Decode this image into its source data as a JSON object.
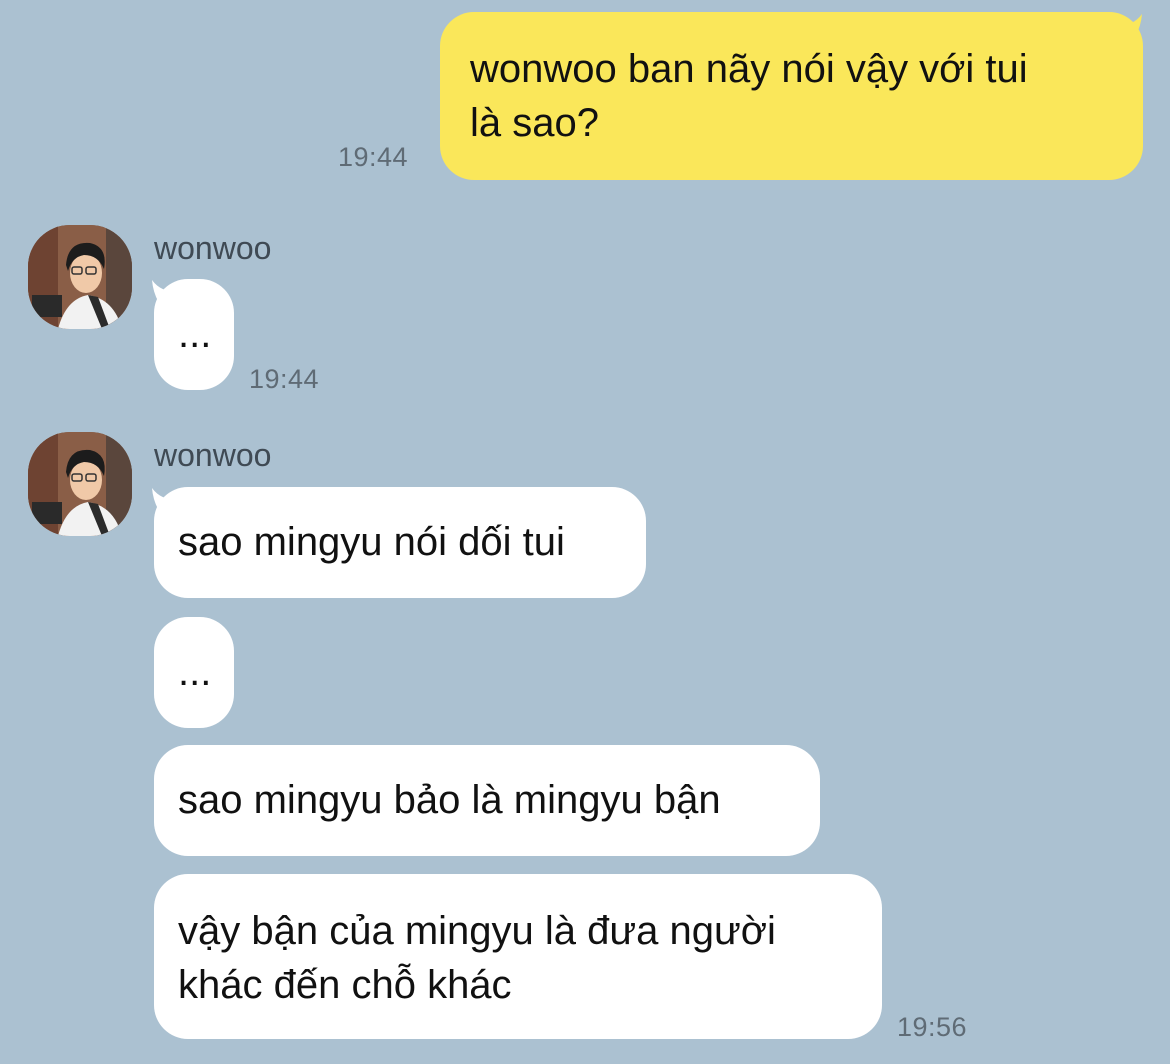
{
  "chat": {
    "outgoing": [
      {
        "text": "wonwoo ban nãy nói vậy với tui\nlà sao?",
        "time": "19:44"
      }
    ],
    "groups": [
      {
        "sender": "wonwoo",
        "avatar_icon": "profile-photo-avatar",
        "messages": [
          {
            "text": "..."
          }
        ],
        "time": "19:44"
      },
      {
        "sender": "wonwoo",
        "avatar_icon": "profile-photo-avatar",
        "messages": [
          {
            "text": "sao mingyu nói dối tui"
          },
          {
            "text": "..."
          },
          {
            "text": "sao mingyu bảo là mingyu bận"
          },
          {
            "text": "vậy bận của mingyu là đưa người\nkhác đến chỗ khác"
          }
        ],
        "time": "19:56"
      }
    ]
  },
  "colors": {
    "background": "#abc1d1",
    "outgoing_bubble": "#fae75a",
    "incoming_bubble": "#ffffff"
  }
}
